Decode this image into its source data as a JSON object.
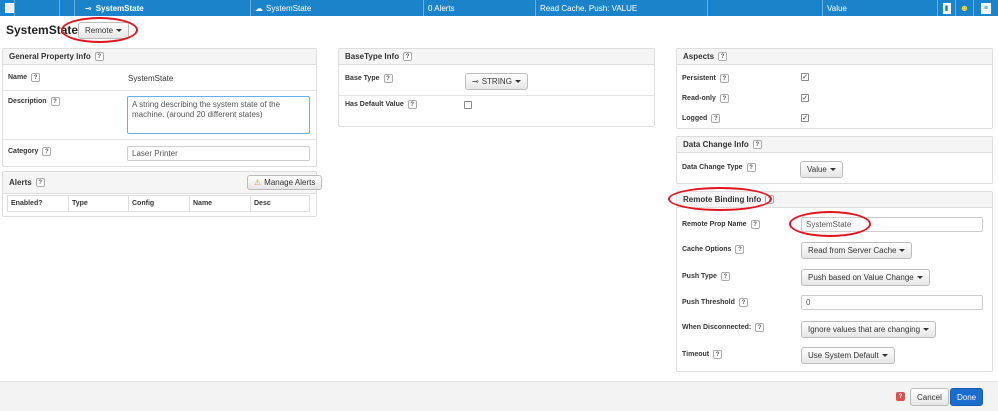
{
  "toprow": {
    "property_name": "SystemState",
    "remote_name": "SystemState",
    "alerts": "0 Alerts",
    "binding_summary": "Read Cache, Push: VALUE",
    "change_type": "Value"
  },
  "header": {
    "title": "SystemState",
    "remote_button": "Remote"
  },
  "general": {
    "title": "General Property Info",
    "name_label": "Name",
    "name_value": "SystemState",
    "description_label": "Description",
    "description_value": "A string describing the system state of the machine. (around 20 different states)",
    "category_label": "Category",
    "category_value": "Laser Printer"
  },
  "alerts": {
    "title": "Alerts",
    "manage_button": "Manage Alerts",
    "columns": [
      "Enabled?",
      "Type",
      "Config",
      "Name",
      "Desc"
    ]
  },
  "basetype": {
    "title": "BaseType Info",
    "base_type_label": "Base Type",
    "base_type_value": "STRING",
    "default_label": "Has Default Value"
  },
  "aspects": {
    "title": "Aspects",
    "persistent_label": "Persistent",
    "readonly_label": "Read-only",
    "logged_label": "Logged"
  },
  "datachange": {
    "title": "Data Change Info",
    "type_label": "Data Change Type",
    "type_value": "Value"
  },
  "remote": {
    "title": "Remote Binding Info",
    "prop_name_label": "Remote Prop Name",
    "prop_name_value": "SystemState",
    "cache_label": "Cache Options",
    "cache_value": "Read from Server Cache",
    "push_label": "Push Type",
    "push_value": "Push based on Value Change",
    "threshold_label": "Push Threshold",
    "threshold_value": "0",
    "disconnected_label": "When Disconnected:",
    "disconnected_value": "Ignore values that are changing",
    "timeout_label": "Timeout",
    "timeout_value": "Use System Default"
  },
  "footer": {
    "cancel": "Cancel",
    "done": "Done"
  },
  "colors": {
    "accent": "#1b83c9",
    "done": "#1a6dcc",
    "highlight": "#e0141e"
  },
  "help_glyph": "?"
}
